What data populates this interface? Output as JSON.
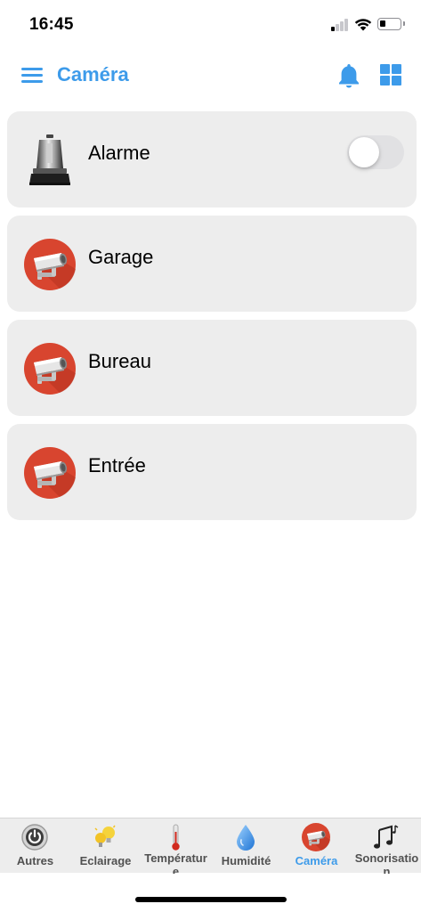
{
  "status_bar": {
    "time": "16:45",
    "icons": [
      "signal-icon",
      "wifi-icon",
      "battery-icon"
    ]
  },
  "header": {
    "title": "Caméra",
    "icons": [
      "menu-icon",
      "bell-icon",
      "grid-icon"
    ]
  },
  "devices": [
    {
      "label": "Alarme",
      "icon": "alarm-siren-icon",
      "toggle_on": false
    },
    {
      "label": "Garage",
      "icon": "security-camera-icon"
    },
    {
      "label": "Bureau",
      "icon": "security-camera-icon"
    },
    {
      "label": "Entrée",
      "icon": "security-camera-icon"
    }
  ],
  "tabs": [
    {
      "label": "Autres",
      "icon": "power-button-icon",
      "active": false
    },
    {
      "label": "Eclairage",
      "icon": "light-bulbs-icon",
      "active": false
    },
    {
      "label": "Température",
      "icon": "thermometer-icon",
      "active": false
    },
    {
      "label": "Humidité",
      "icon": "water-drop-icon",
      "active": false
    },
    {
      "label": "Caméra",
      "icon": "security-camera-icon",
      "active": true
    },
    {
      "label": "Sonorisation",
      "icon": "music-notes-icon",
      "active": false
    }
  ],
  "colors": {
    "accent": "#3d9bea",
    "card_background": "#ededed",
    "camera_badge": "#d8452f",
    "tab_bar": "#ededed"
  }
}
